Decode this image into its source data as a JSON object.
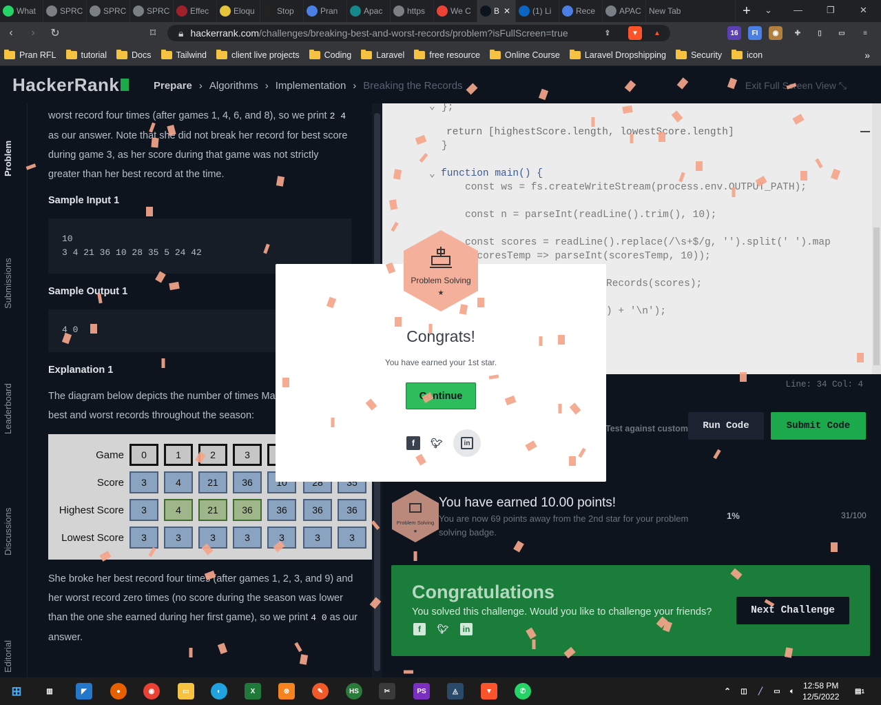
{
  "browser": {
    "tabs": [
      {
        "label": "What",
        "icon": "whatsapp-icon",
        "color": "#25d366"
      },
      {
        "label": "SPRC",
        "icon": "globe-icon",
        "color": "#7a7f86"
      },
      {
        "label": "SPRC",
        "icon": "globe-icon",
        "color": "#7a7f86"
      },
      {
        "label": "SPRC",
        "icon": "globe-icon",
        "color": "#7a7f86"
      },
      {
        "label": "Effec",
        "icon": "tp-icon",
        "color": "#a0202c"
      },
      {
        "label": "Eloqu",
        "icon": "js-icon",
        "color": "#e5c43c"
      },
      {
        "label": "Stop",
        "icon": "dn-icon",
        "color": "#222"
      },
      {
        "label": "Pran",
        "icon": "docs-icon",
        "color": "#4a7fe5"
      },
      {
        "label": "Apac",
        "icon": "globe-icon",
        "color": "#14888a"
      },
      {
        "label": "https",
        "icon": "globe-icon",
        "color": "#7a7f86"
      },
      {
        "label": "We C",
        "icon": "gmail-icon",
        "color": "#ea4335"
      },
      {
        "label": "B",
        "icon": "hackerrank-icon",
        "color": "#0e141e",
        "active": true
      },
      {
        "label": "(1) Li",
        "icon": "linkedin-icon",
        "color": "#0a66c2"
      },
      {
        "label": "Rece",
        "icon": "gear-icon",
        "color": "#4a7fe5"
      },
      {
        "label": "APAC",
        "icon": "globe-icon",
        "color": "#7a7f86"
      },
      {
        "label": "New Tab",
        "icon": "",
        "color": "#202124"
      }
    ],
    "url_domain": "hackerrank.com",
    "url_path": "/challenges/breaking-best-and-worst-records/problem?isFullScreen=true",
    "ext_badge_count": "3",
    "profile_badge": "16",
    "bookmarks": [
      "Pran RFL",
      "tutorial",
      "Docs",
      "Tailwind",
      "client live projects",
      "Coding",
      "Laravel",
      "free resource",
      "Online Course",
      "Laravel Dropshipping",
      "Security",
      "icon"
    ],
    "more_bookmarks": "»"
  },
  "header": {
    "logo": "HackerRank",
    "breadcrumbs": [
      "Prepare",
      "Algorithms",
      "Implementation",
      "Breaking the Records"
    ],
    "exit_fullscreen": "Exit Full Screen View"
  },
  "sidebar_tabs": [
    "Problem",
    "Submissions",
    "Leaderboard",
    "Discussions",
    "Editorial"
  ],
  "problem": {
    "para1_line1": "worst record four times (after games 1, 4, 6, and 8), so we print ",
    "para1_code": "2 4",
    "para1_rest": "as our answer. Note that she did not break her record for best score during game 3, as her score during that game was not strictly greater than her best record at the time.",
    "sample_input_title": "Sample Input 1",
    "sample_input_line1": "10",
    "sample_input_line2": "3 4 21 36 10 28 35 5 24 42",
    "sample_output_title": "Sample Output 1",
    "sample_output": "4 0",
    "explanation_title": "Explanation 1",
    "explanation_text": "The diagram below depicts the number of times Maria broke her best and worst records throughout the season:",
    "diagram": {
      "rows": [
        {
          "label": "Game",
          "cells": [
            "0",
            "1",
            "2",
            "3",
            "",
            "",
            ""
          ],
          "style": "k"
        },
        {
          "label": "Score",
          "cells": [
            "3",
            "4",
            "21",
            "36",
            "10",
            "28",
            "35"
          ],
          "style": "b"
        },
        {
          "label": "Highest Score",
          "cells": [
            "3",
            "4",
            "21",
            "36",
            "36",
            "36",
            "36"
          ],
          "style": "hl"
        },
        {
          "label": "Lowest Score",
          "cells": [
            "3",
            "3",
            "3",
            "3",
            "3",
            "3",
            "3"
          ],
          "style": "b"
        }
      ]
    },
    "para2": "She broke her best record four times (after games 1, 2, 3, and 9) and her worst record zero times (no score during the season was lower than the one she earned during her first game), so we print ",
    "para2_code": "4 0",
    "para2_end": " as our answer."
  },
  "editor": {
    "lines": [
      {
        "text": "};"
      },
      {
        "text": "return [highestScore.length, lowestScore.length]"
      },
      {
        "text": "}"
      },
      {
        "text": "function main() {"
      },
      {
        "text": "const ws = fs.createWriteStream(process.env.OUTPUT_PATH);"
      },
      {
        "text": "const n = parseInt(readLine().trim(), 10);"
      },
      {
        "text": "const scores = readLine().replace(/\\s+$/g, '').split(' ').map"
      },
      {
        "text": "(scoresTemp => parseInt(scoresTemp, 10));"
      },
      {
        "text": "Records(scores);"
      },
      {
        "text": ") + '\\n');"
      }
    ],
    "status": "Line: 34 Col: 4",
    "custom_input": "Test against custom input",
    "run_label": "Run Code",
    "submit_label": "Submit Code"
  },
  "points": {
    "badge_label": "Problem Solving",
    "title": "You have earned 10.00 points!",
    "subtitle": "You are now 69 points away from the 2nd star for your problem solving badge.",
    "percent": "1%",
    "progress": "31/100",
    "progress_fraction": 0.01
  },
  "congrats_box": {
    "title": "Congratulations",
    "subtitle": "You solved this challenge. Would you like to challenge your friends?",
    "next_label": "Next Challenge"
  },
  "modal": {
    "badge_label": "Problem Solving",
    "badge_star": "★",
    "title": "Congrats!",
    "subtitle": "You have earned your 1st star.",
    "continue_label": "Continue"
  },
  "taskbar": {
    "time": "12:58 PM",
    "date": "12/5/2022",
    "notification_count": "1"
  },
  "colors": {
    "brand_green": "#1ba94c",
    "confetti": "#f4a58a",
    "badge": "#f5b09c"
  }
}
